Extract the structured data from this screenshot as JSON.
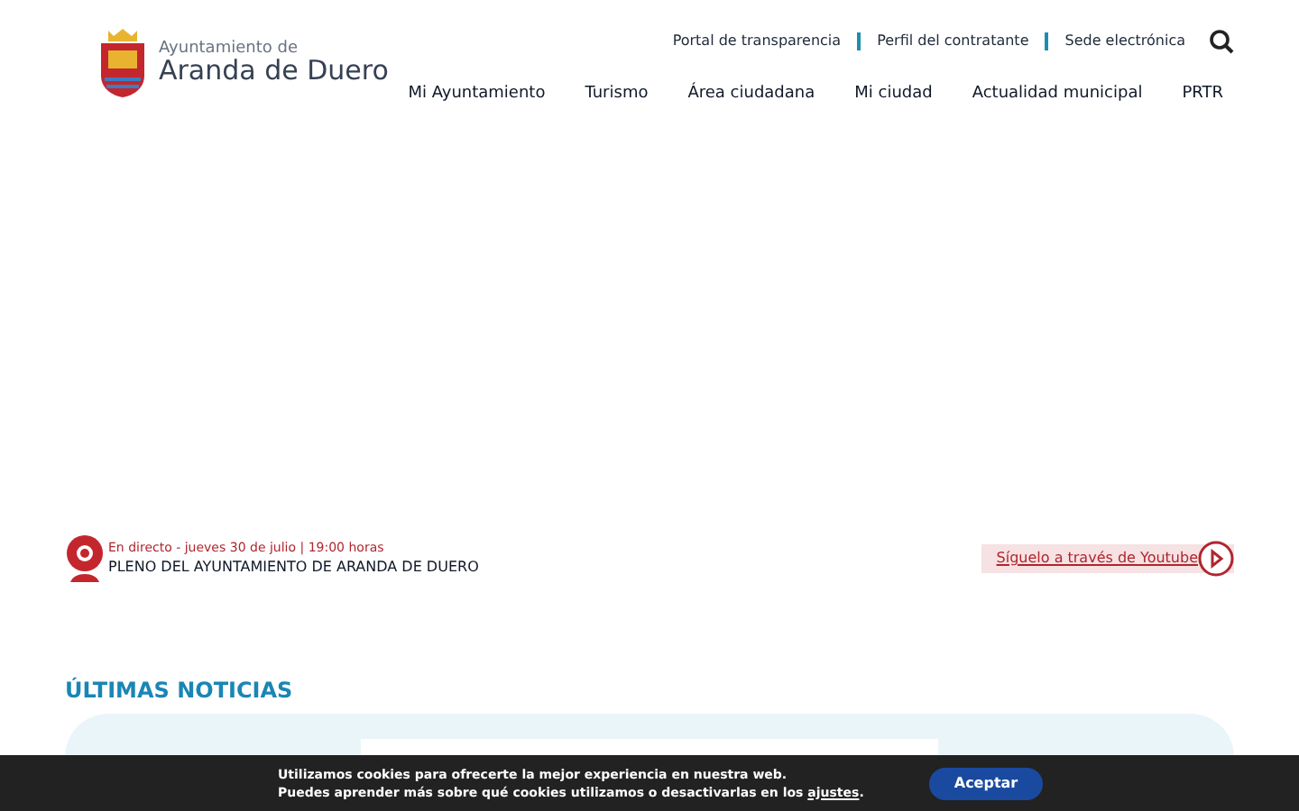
{
  "logo": {
    "subtitle": "Ayuntamiento de",
    "title": "Aranda de Duero"
  },
  "top_links": [
    "Portal de transparencia",
    "Perfil del contratante",
    "Sede electrónica"
  ],
  "main_nav": [
    "Mi Ayuntamiento",
    "Turismo",
    "Área ciudadana",
    "Mi ciudad",
    "Actualidad municipal",
    "PRTR"
  ],
  "live": {
    "meta": "En directo - jueves 30 de julio | 19:00 horas",
    "title": "PLENO DEL AYUNTAMIENTO DE ARANDA DE DUERO",
    "youtube_link": "Síguelo a través de Youtube"
  },
  "news": {
    "heading": "ÚLTIMAS NOTICIAS"
  },
  "cookie_bar": {
    "line1": "Utilizamos cookies para ofrecerte la mejor experiencia en nuestra web.",
    "line2": "Puedes aprender más sobre qué cookies utilizamos o desactivarlas en los",
    "link": "ajustes",
    "end": ".",
    "button": "Aceptar"
  }
}
